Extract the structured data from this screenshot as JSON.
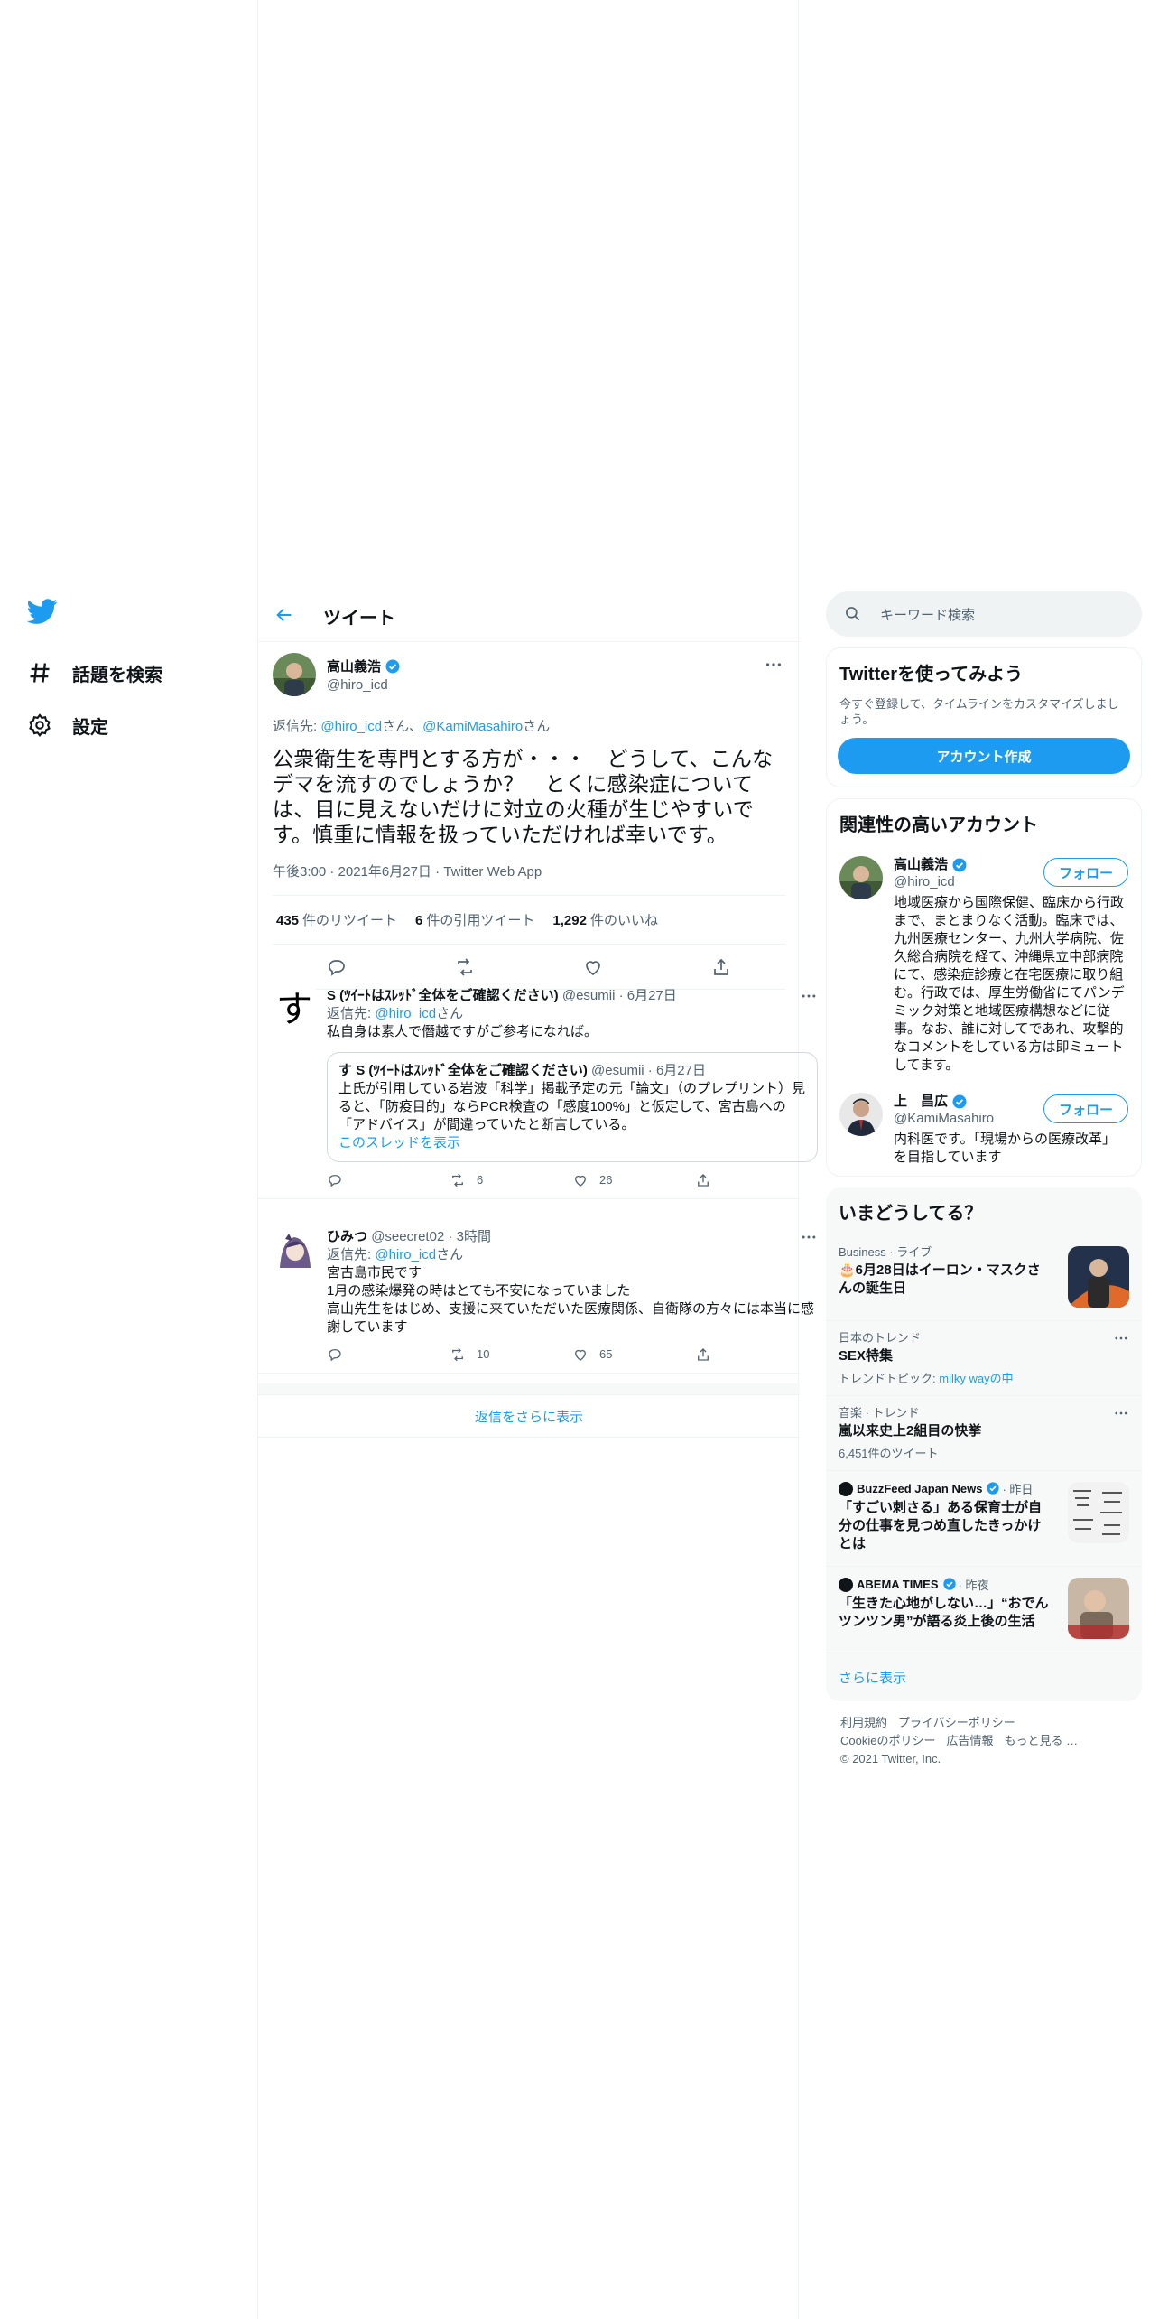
{
  "nav": {
    "logo": "twitter-bird-icon",
    "items": [
      {
        "label": "話題を検索",
        "icon": "hashtag-icon"
      },
      {
        "label": "設定",
        "icon": "gear-icon"
      }
    ]
  },
  "header": {
    "title": "ツイート"
  },
  "main_tweet": {
    "name": "高山義浩",
    "handle": "@hiro_icd",
    "reply_prefix": "返信先: ",
    "reply_user1": "@hiro_icd",
    "reply_mid": "さん、",
    "reply_user2": "@KamiMasahiro",
    "reply_suffix": "さん",
    "text": "公衆衛生を専門とする方が・・・　どうして、こんなデマを流すのでしょうか？　とくに感染症については、目に見えないだけに対立の火種が生じやすいです。慎重に情報を扱っていただければ幸いです。",
    "meta": "午後3:00 · 2021年6月27日 · Twitter Web App",
    "retweets_num": "435",
    "retweets_label": "件のリツイート",
    "quotes_num": "6",
    "quotes_label": "件の引用ツイート",
    "likes_num": "1,292",
    "likes_label": "件のいいね"
  },
  "replies": [
    {
      "name": "S (ﾂｲｰﾄはｽﾚｯﾄﾞ全体をご確認ください)",
      "handle": "@esumii",
      "time": "· 6月27日",
      "reply_prefix": "返信先: ",
      "reply_user": "@hiro_icd",
      "reply_suffix": "さん",
      "text": "私自身は素人で僭越ですがご参考になれば。",
      "avatar_char": "す",
      "quote": {
        "avatar_char": "す",
        "name": "S (ﾂｲｰﾄはｽﾚｯﾄﾞ全体をご確認ください)",
        "handle": "@esumii",
        "time": "· 6月27日",
        "text": "上氏が引用している岩波「科学」掲載予定の元「論文」（のプレプリント）見ると、「防疫目的」ならPCR検査の「感度100%」と仮定して、宮古島への「アドバイス」が間違っていたと断言している。",
        "link": "このスレッドを表示"
      },
      "retweets": "6",
      "likes": "26"
    },
    {
      "name": "ひみつ",
      "handle": "@seecret02",
      "time": "· 3時間",
      "reply_prefix": "返信先: ",
      "reply_user": "@hiro_icd",
      "reply_suffix": "さん",
      "lines": [
        "宮古島市民です",
        "1月の感染爆発の時はとても不安になっていました",
        "高山先生をはじめ、支援に来ていただいた医療関係、自衛隊の方々には本当に感謝しています"
      ],
      "retweets": "10",
      "likes": "65"
    }
  ],
  "more_replies": "返信をさらに表示",
  "search": {
    "placeholder": "キーワード検索"
  },
  "signup": {
    "title": "Twitterを使ってみよう",
    "desc": "今すぐ登録して、タイムラインをカスタマイズしましょう。",
    "button": "アカウント作成"
  },
  "related": {
    "title": "関連性の高いアカウント",
    "follow_label": "フォロー",
    "accounts": [
      {
        "name": "高山義浩",
        "handle": "@hiro_icd",
        "bio": "地域医療から国際保健、臨床から行政まで、まとまりなく活動。臨床では、九州医療センター、九州大学病院、佐久総合病院を経て、沖縄県立中部病院にて、感染症診療と在宅医療に取り組む。行政では、厚生労働省にてパンデミック対策と地域医療構想などに従事。なお、誰に対してであれ、攻撃的なコメントをしている方は即ミュートしてます。"
      },
      {
        "name": "上　昌広",
        "handle": "@KamiMasahiro",
        "bio": "内科医です。「現場からの医療改革」を目指しています"
      }
    ]
  },
  "trends": {
    "title": "いまどうしてる？",
    "items": [
      {
        "category": "Business · ライブ",
        "title": "🎂6月28日はイーロン・マスクさんの誕生日"
      },
      {
        "category": "日本のトレンド",
        "title": "SEX特集",
        "sub_prefix": "トレンドトピック: ",
        "sub_link": "milky wayの中"
      },
      {
        "category": "音楽 · トレンド",
        "title": "嵐以来史上2組目の快挙",
        "sub": "6,451件のツイート"
      },
      {
        "source": "BuzzFeed Japan News",
        "time": "· 昨日",
        "title": "「すごい刺さる」ある保育士が自分の仕事を見つめ直したきっかけとは"
      },
      {
        "source": "ABEMA TIMES",
        "time": "· 昨夜",
        "title": "「生きた心地がしない…」“おでんツンツン男”が語る炎上後の生活"
      }
    ],
    "show_more": "さらに表示"
  },
  "footer": {
    "links1": [
      "利用規約",
      "プライバシーポリシー"
    ],
    "links2": [
      "Cookieのポリシー",
      "広告情報",
      "もっと見る …"
    ],
    "copyright": "© 2021 Twitter, Inc."
  },
  "colors": {
    "accent": "#1d9bf0",
    "text": "#0f1419",
    "muted": "#536471"
  }
}
